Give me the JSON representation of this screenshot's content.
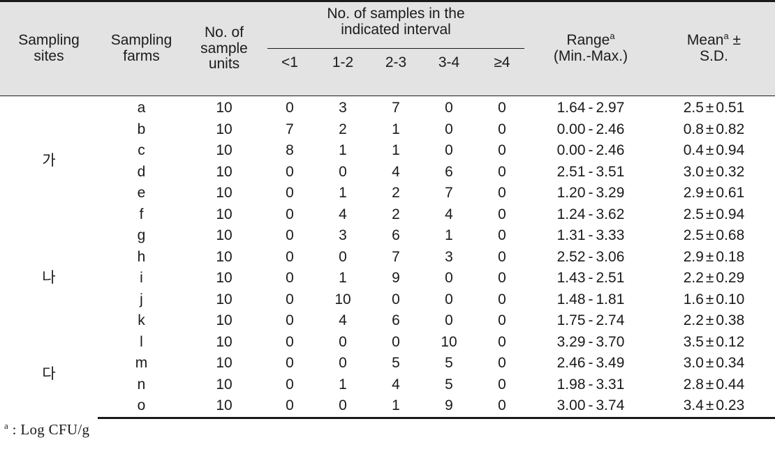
{
  "table": {
    "headers": {
      "sampling_sites": "Sampling\nsites",
      "sampling_sites_line1": "Sampling",
      "sampling_sites_line2": "sites",
      "sampling_farms_line1": "Sampling",
      "sampling_farms_line2": "farms",
      "sample_units_line1": "No. of",
      "sample_units_line2": "sample",
      "sample_units_line3": "units",
      "interval_group_line1": "No. of samples in the",
      "interval_group_line2": "indicated interval",
      "intervals": [
        "<1",
        "1-2",
        "2-3",
        "3-4",
        "≥4"
      ],
      "range_line1": "Range",
      "range_line1_sup": "a",
      "range_line2": "(Min.-Max.)",
      "mean_line1": "Mean",
      "mean_line1_sup": "a",
      "mean_line1_tail": " ±",
      "mean_line2": "S.D."
    },
    "site_labels": {
      "site1": "가",
      "site2": "나",
      "site3": "다"
    },
    "rows": [
      {
        "farm": "a",
        "units": "10",
        "i1": "0",
        "i2": "3",
        "i3": "7",
        "i4": "0",
        "i5": "0",
        "range_min": "1.64",
        "range_sep": "-",
        "range_max": "2.97",
        "mean": "2.5",
        "pm": "±",
        "sd": "0.51"
      },
      {
        "farm": "b",
        "units": "10",
        "i1": "7",
        "i2": "2",
        "i3": "1",
        "i4": "0",
        "i5": "0",
        "range_min": "0.00",
        "range_sep": "-",
        "range_max": "2.46",
        "mean": "0.8",
        "pm": "±",
        "sd": "0.82"
      },
      {
        "farm": "c",
        "units": "10",
        "i1": "8",
        "i2": "1",
        "i3": "1",
        "i4": "0",
        "i5": "0",
        "range_min": "0.00",
        "range_sep": "-",
        "range_max": "2.46",
        "mean": "0.4",
        "pm": "±",
        "sd": "0.94"
      },
      {
        "farm": "d",
        "units": "10",
        "i1": "0",
        "i2": "0",
        "i3": "4",
        "i4": "6",
        "i5": "0",
        "range_min": "2.51",
        "range_sep": "-",
        "range_max": "3.51",
        "mean": "3.0",
        "pm": "±",
        "sd": "0.32"
      },
      {
        "farm": "e",
        "units": "10",
        "i1": "0",
        "i2": "1",
        "i3": "2",
        "i4": "7",
        "i5": "0",
        "range_min": "1.20",
        "range_sep": "-",
        "range_max": "3.29",
        "mean": "2.9",
        "pm": "±",
        "sd": "0.61"
      },
      {
        "farm": "f",
        "units": "10",
        "i1": "0",
        "i2": "4",
        "i3": "2",
        "i4": "4",
        "i5": "0",
        "range_min": "1.24",
        "range_sep": "-",
        "range_max": "3.62",
        "mean": "2.5",
        "pm": "±",
        "sd": "0.94"
      },
      {
        "farm": "g",
        "units": "10",
        "i1": "0",
        "i2": "3",
        "i3": "6",
        "i4": "1",
        "i5": "0",
        "range_min": "1.31",
        "range_sep": "-",
        "range_max": "3.33",
        "mean": "2.5",
        "pm": "±",
        "sd": "0.68"
      },
      {
        "farm": "h",
        "units": "10",
        "i1": "0",
        "i2": "0",
        "i3": "7",
        "i4": "3",
        "i5": "0",
        "range_min": "2.52",
        "range_sep": "-",
        "range_max": "3.06",
        "mean": "2.9",
        "pm": "±",
        "sd": "0.18"
      },
      {
        "farm": "i",
        "units": "10",
        "i1": "0",
        "i2": "1",
        "i3": "9",
        "i4": "0",
        "i5": "0",
        "range_min": "1.43",
        "range_sep": "-",
        "range_max": "2.51",
        "mean": "2.2",
        "pm": "±",
        "sd": "0.29"
      },
      {
        "farm": "j",
        "units": "10",
        "i1": "0",
        "i2": "10",
        "i3": "0",
        "i4": "0",
        "i5": "0",
        "range_min": "1.48",
        "range_sep": "-",
        "range_max": "1.81",
        "mean": "1.6",
        "pm": "±",
        "sd": "0.10"
      },
      {
        "farm": "k",
        "units": "10",
        "i1": "0",
        "i2": "4",
        "i3": "6",
        "i4": "0",
        "i5": "0",
        "range_min": "1.75",
        "range_sep": "-",
        "range_max": "2.74",
        "mean": "2.2",
        "pm": "±",
        "sd": "0.38"
      },
      {
        "farm": "l",
        "units": "10",
        "i1": "0",
        "i2": "0",
        "i3": "0",
        "i4": "10",
        "i5": "0",
        "range_min": "3.29",
        "range_sep": "-",
        "range_max": "3.70",
        "mean": "3.5",
        "pm": "±",
        "sd": "0.12"
      },
      {
        "farm": "m",
        "units": "10",
        "i1": "0",
        "i2": "0",
        "i3": "5",
        "i4": "5",
        "i5": "0",
        "range_min": "2.46",
        "range_sep": "-",
        "range_max": "3.49",
        "mean": "3.0",
        "pm": "±",
        "sd": "0.34"
      },
      {
        "farm": "n",
        "units": "10",
        "i1": "0",
        "i2": "1",
        "i3": "4",
        "i4": "5",
        "i5": "0",
        "range_min": "1.98",
        "range_sep": "-",
        "range_max": "3.31",
        "mean": "2.8",
        "pm": "±",
        "sd": "0.44"
      },
      {
        "farm": "o",
        "units": "10",
        "i1": "0",
        "i2": "0",
        "i3": "1",
        "i4": "9",
        "i5": "0",
        "range_min": "3.00",
        "range_sep": "-",
        "range_max": "3.74",
        "mean": "3.4",
        "pm": "±",
        "sd": "0.23"
      }
    ],
    "footnote": {
      "mark": "a",
      "text": " :  Log  CFU/g"
    }
  },
  "colors": {
    "header_background": "#e3e3e3",
    "rule": "#1a1a1a",
    "text": "#1a1a1a",
    "page_background": "#ffffff"
  }
}
